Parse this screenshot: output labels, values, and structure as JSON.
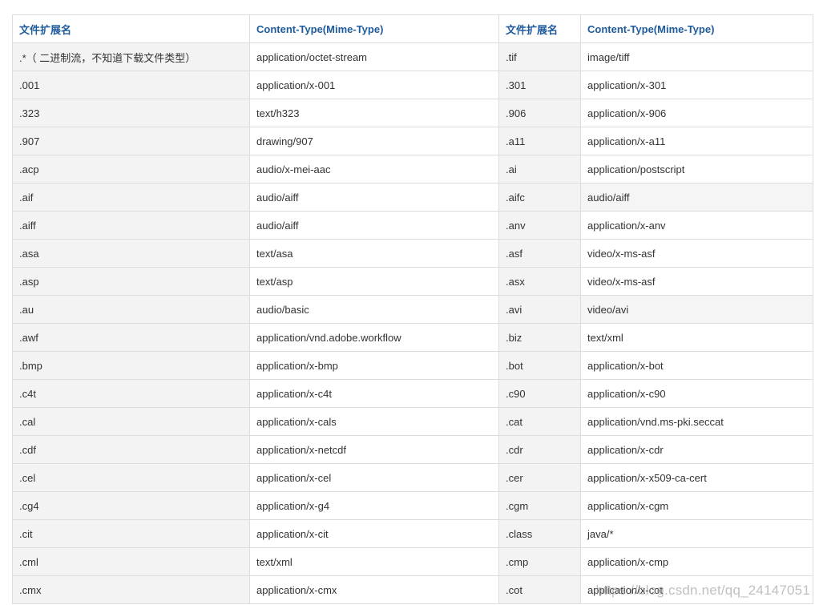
{
  "table": {
    "headers": [
      "文件扩展名",
      "Content-Type(Mime-Type)",
      "文件扩展名",
      "Content-Type(Mime-Type)"
    ],
    "rows": [
      [
        ".*（ 二进制流，不知道下载文件类型）",
        "application/octet-stream",
        ".tif",
        "image/tiff"
      ],
      [
        ".001",
        "application/x-001",
        ".301",
        "application/x-301"
      ],
      [
        ".323",
        "text/h323",
        ".906",
        "application/x-906"
      ],
      [
        ".907",
        "drawing/907",
        ".a11",
        "application/x-a11"
      ],
      [
        ".acp",
        "audio/x-mei-aac",
        ".ai",
        "application/postscript"
      ],
      [
        ".aif",
        "audio/aiff",
        ".aifc",
        "audio/aiff"
      ],
      [
        ".aiff",
        "audio/aiff",
        ".anv",
        "application/x-anv"
      ],
      [
        ".asa",
        "text/asa",
        ".asf",
        "video/x-ms-asf"
      ],
      [
        ".asp",
        "text/asp",
        ".asx",
        "video/x-ms-asf"
      ],
      [
        ".au",
        "audio/basic",
        ".avi",
        "video/avi"
      ],
      [
        ".awf",
        "application/vnd.adobe.workflow",
        ".biz",
        "text/xml"
      ],
      [
        ".bmp",
        "application/x-bmp",
        ".bot",
        "application/x-bot"
      ],
      [
        ".c4t",
        "application/x-c4t",
        ".c90",
        "application/x-c90"
      ],
      [
        ".cal",
        "application/x-cals",
        ".cat",
        "application/vnd.ms-pki.seccat"
      ],
      [
        ".cdf",
        "application/x-netcdf",
        ".cdr",
        "application/x-cdr"
      ],
      [
        ".cel",
        "application/x-cel",
        ".cer",
        "application/x-x509-ca-cert"
      ],
      [
        ".cg4",
        "application/x-g4",
        ".cgm",
        "application/x-cgm"
      ],
      [
        ".cit",
        "application/x-cit",
        ".class",
        "java/*"
      ],
      [
        ".cml",
        "text/xml",
        ".cmp",
        "application/x-cmp"
      ],
      [
        ".cmx",
        "application/x-cmx",
        ".cot",
        "application/x-cot"
      ]
    ]
  },
  "watermark": "https://blog.csdn.net/qq_24147051"
}
